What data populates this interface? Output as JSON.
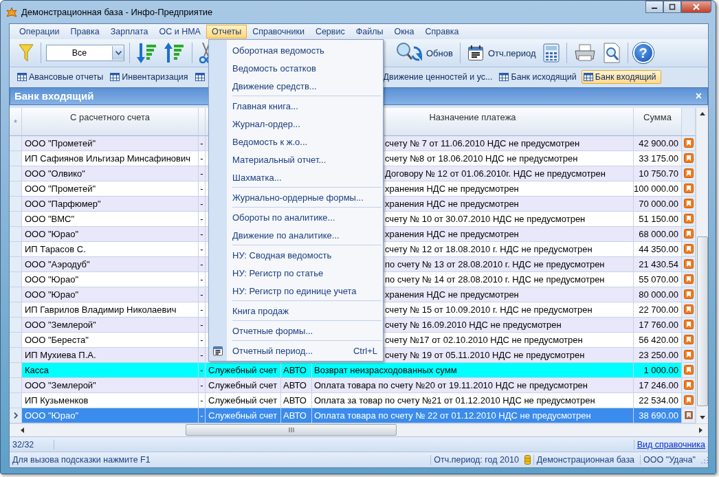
{
  "window": {
    "title": "Демонстрационная база - Инфо-Предприятие"
  },
  "menu_bar": [
    {
      "label": "Операции",
      "selected": false
    },
    {
      "label": "Правка",
      "selected": false
    },
    {
      "label": "Зарплата",
      "selected": false
    },
    {
      "label": "ОС и НМА",
      "selected": false
    },
    {
      "label": "Отчеты",
      "selected": true
    },
    {
      "label": "Справочники",
      "selected": false
    },
    {
      "label": "Сервис",
      "selected": false
    },
    {
      "label": "Файлы",
      "selected": false
    },
    {
      "label": "Окна",
      "selected": false
    },
    {
      "label": "Справка",
      "selected": false
    }
  ],
  "toolbar": {
    "filter": {
      "value": "Все"
    },
    "refresh_label": "Обнов",
    "period_label": "Отч.период",
    "help_label": "?"
  },
  "tabs": [
    {
      "label": "Авансовые отчеты",
      "selected": false,
      "cut": false
    },
    {
      "label": "Инвентаризация",
      "selected": false,
      "cut": false
    },
    {
      "selected": false,
      "cut": false
    },
    {
      "label": "Движение ценностей и ус...",
      "selected": false,
      "cut": true
    },
    {
      "label": "Банк исходящий",
      "selected": false,
      "cut": false
    },
    {
      "label": "Банк входящий",
      "selected": true,
      "cut": false
    }
  ],
  "panel": {
    "title": "Банк входящий",
    "close_label": "×"
  },
  "table": {
    "columns": [
      {
        "label": "*"
      },
      {
        "label": "С расчетного счета"
      },
      {},
      {},
      {},
      {
        "label": "Назначение платежа"
      },
      {
        "label": "Сумма"
      },
      {}
    ],
    "rows": [
      {
        "payer": "ООО \"Прометей\"",
        "dash": "-",
        "purpose": "счету № 7 от 11.06.2010 НДС не предусмотрен",
        "amount": "42 900.00",
        "selected": false,
        "highlight": false,
        "current": false
      },
      {
        "payer": "ИП Сафиянов Ильгизар Минсафинович",
        "dash": "-",
        "purpose": "счету №8 от 18.06.2010 НДС не предусмотрен",
        "amount": "33 175.00",
        "selected": false,
        "highlight": false,
        "current": false
      },
      {
        "payer": "ООО \"Олвико\"",
        "dash": "-",
        "purpose": "Договору № 12 от 01.06.2010г. НДС не предусмотрен",
        "amount": "10 750.70",
        "selected": false,
        "highlight": false,
        "current": false
      },
      {
        "payer": "ООО \"Прометей\"",
        "dash": "-",
        "purpose": "хранения НДС не предусмотрен",
        "amount": "100 000.00",
        "selected": false,
        "highlight": false,
        "current": false
      },
      {
        "payer": "ООО \"Парфюмер\"",
        "dash": "-",
        "purpose": "хранения НДС не предусмотрен",
        "amount": "70 000.00",
        "selected": false,
        "highlight": false,
        "current": false
      },
      {
        "payer": "ООО \"ВМС\"",
        "dash": "-",
        "purpose": "счету № 10 от 30.07.2010 НДС не предусмотрен",
        "amount": "51 150.00",
        "selected": false,
        "highlight": false,
        "current": false
      },
      {
        "payer": "ООО \"Юрао\"",
        "dash": "-",
        "purpose": "хранения НДС не предусмотрен",
        "amount": "68 000.00",
        "selected": false,
        "highlight": false,
        "current": false
      },
      {
        "payer": "ИП Тарасов С.",
        "dash": "-",
        "purpose": "счету № 12 от 18.08.2010 г. НДС не предусмотрен",
        "amount": "44 350.00",
        "selected": false,
        "highlight": false,
        "current": false
      },
      {
        "payer": "ООО \"Аэродуб\"",
        "dash": "-",
        "purpose": "по счету № 13 от 28.08.2010 г. НДС не предусмотрен",
        "amount": "21 430.54",
        "selected": false,
        "highlight": false,
        "current": false
      },
      {
        "payer": "ООО \"Юрао\"",
        "dash": "-",
        "purpose": "по счету № 14 от 28.08.2010 г. НДС не предусмотрен",
        "amount": "55 070.00",
        "selected": false,
        "highlight": false,
        "current": false
      },
      {
        "payer": "ООО \"Юрао\"",
        "dash": "-",
        "purpose": "хранения НДС не предусмотрен",
        "amount": "80 000.00",
        "selected": false,
        "highlight": false,
        "current": false
      },
      {
        "payer": "ИП Гаврилов Владимир Николаевич",
        "dash": "-",
        "purpose": "счету № 15 от 10.09.2010 г. НДС не предусмотрен",
        "amount": "22 700.00",
        "selected": false,
        "highlight": false,
        "current": false
      },
      {
        "payer": "ООО \"Землерой\"",
        "dash": "-",
        "purpose": "счету № 16.09.2010 НДС не предусмотрен",
        "amount": "17 760.00",
        "selected": false,
        "highlight": false,
        "current": false
      },
      {
        "payer": "ООО \"Береста\"",
        "dash": "-",
        "purpose": "счету №17 от 02.10.2010 НДС не предусмотрен",
        "amount": "56 420.00",
        "selected": false,
        "highlight": false,
        "current": false
      },
      {
        "payer": "ИП Мухиева П.А.",
        "dash": "-",
        "purpose": "счету № 19 от 05.11.2010 НДС не предусмотрен",
        "amount": "23 250.00",
        "selected": false,
        "highlight": false,
        "current": false
      },
      {
        "payer": "Касса",
        "dash": "-",
        "account": "Служебный счет",
        "source": "АВТО",
        "purpose": "Возврат неизрасходованных сумм",
        "amount": "1 000.00",
        "selected": false,
        "highlight": true,
        "current": false
      },
      {
        "payer": "ООО \"Землерой\"",
        "dash": "-",
        "account": "Служебный счет",
        "source": "АВТО",
        "purpose": "Оплата товара по счету №20 от 19.11.2010 НДС не предусмотрен",
        "amount": "17 246.00",
        "selected": false,
        "highlight": false,
        "current": false
      },
      {
        "payer": "ИП Кузьменков",
        "dash": "-",
        "account": "Служебный счет",
        "source": "АВТО",
        "purpose": "Оплата за товар по счету №21 от 01.12.2010 НДС не предусмотрен",
        "amount": "22 534.00",
        "selected": false,
        "highlight": false,
        "current": false
      },
      {
        "payer": "ООО \"Юрао\"",
        "dash": "-",
        "account": "Служебный счет",
        "source": "АВТО",
        "purpose": "Оплата товара по счету № 22 от 01.12.2010 НДС не предусмотрен",
        "amount": "38 690.00",
        "selected": true,
        "highlight": false,
        "current": true
      }
    ]
  },
  "footer": {
    "count": "32/32",
    "link": "Вид справочника"
  },
  "status_bar": {
    "hint": "Для вызова подсказки нажмите F1",
    "period": "Отч.период: год 2010",
    "database": "Демонстрационная база",
    "company": "ООО \"Удача\""
  },
  "reports_menu": {
    "groups": [
      [
        {
          "label": "Оборотная ведомость"
        },
        {
          "label": "Ведомость остатков"
        },
        {
          "label": "Движение средств..."
        }
      ],
      [
        {
          "label": "Главная книга..."
        },
        {
          "label": "Журнал-ордер..."
        },
        {
          "label": "Ведомость к ж.о..."
        },
        {
          "label": "Материальный отчет..."
        },
        {
          "label": "Шахматка..."
        }
      ],
      [
        {
          "label": "Журнально-ордерные формы..."
        }
      ],
      [
        {
          "label": "Обороты по аналитике..."
        },
        {
          "label": "Движение по аналитике..."
        }
      ],
      [
        {
          "label": "НУ: Сводная ведомость"
        },
        {
          "label": "НУ: Регистр по статье"
        },
        {
          "label": "НУ: Регистр по единице учета"
        }
      ],
      [
        {
          "label": "Книга продаж"
        }
      ],
      [
        {
          "label": "Отчетные формы..."
        }
      ],
      [
        {
          "label": "Отчетный период...",
          "shortcut": "Ctrl+L",
          "has_icon": true
        }
      ]
    ]
  }
}
